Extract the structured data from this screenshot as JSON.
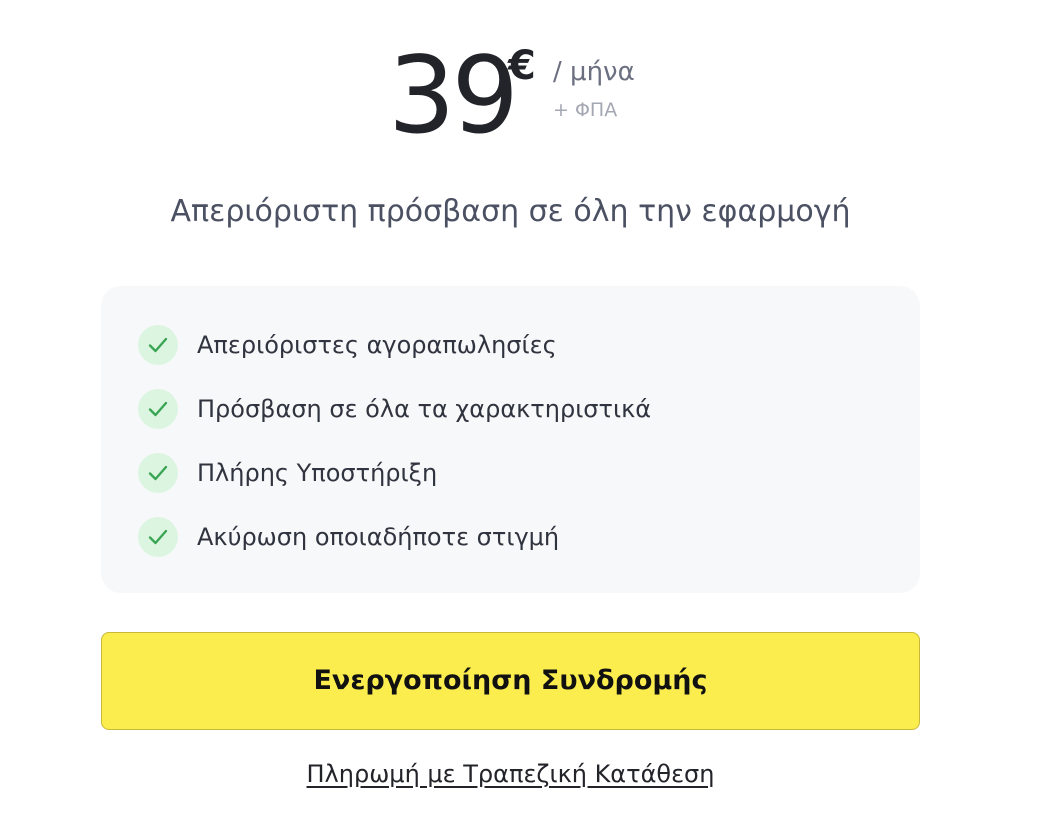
{
  "pricing": {
    "amount": "39",
    "currency_symbol": "€",
    "period": "/ μήνα",
    "tax_note": "+ ΦΠΑ"
  },
  "plan": {
    "subtitle": "Απεριόριστη πρόσβαση σε όλη την εφαρμογή"
  },
  "features": {
    "items": [
      {
        "label": "Απεριόριστες αγοραπωλησίες",
        "icon": "check-icon"
      },
      {
        "label": "Πρόσβαση σε όλα τα χαρακτηριστικά",
        "icon": "check-icon"
      },
      {
        "label": "Πλήρης Υποστήριξη",
        "icon": "check-icon"
      },
      {
        "label": "Ακύρωση οποιαδήποτε στιγμή",
        "icon": "check-icon"
      }
    ]
  },
  "actions": {
    "activate_label": "Ενεργοποίηση Συνδρομής",
    "bank_transfer_label": "Πληρωμή με Τραπεζική Κατάθεση"
  },
  "colors": {
    "accent_button": "#fbed4e",
    "check_bg": "#dcf5e1",
    "check_stroke": "#3aa654",
    "card_bg": "#f7f8fa"
  }
}
